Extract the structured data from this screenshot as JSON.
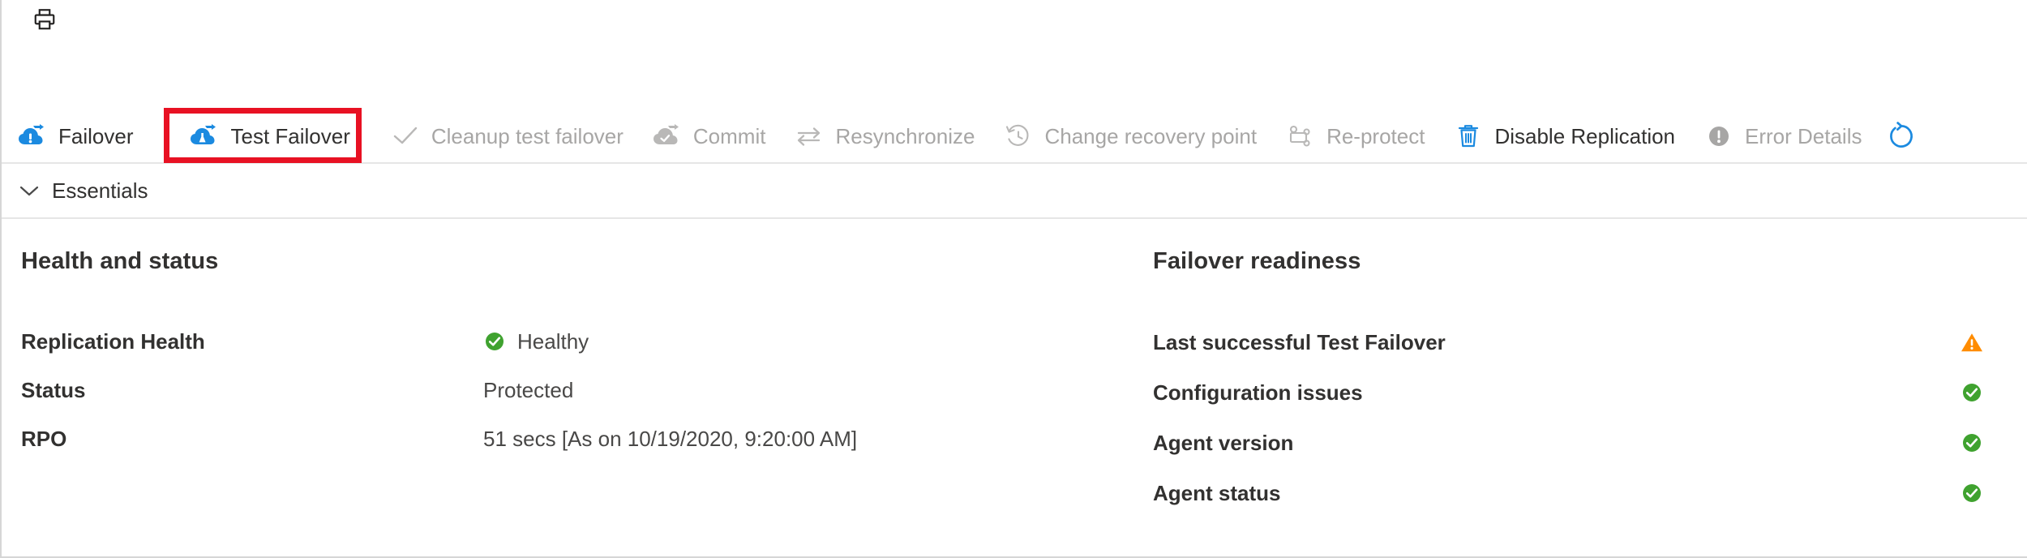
{
  "topbar": {
    "print_icon": "print-icon",
    "clipped_left_icons": [
      "partial-blue-icon-1",
      "partial-blue-icon-2"
    ]
  },
  "commandbar": {
    "items": [
      {
        "label": "Failover",
        "icon": "failover-cloud-icon",
        "enabled": true,
        "name": "failover"
      },
      {
        "label": "Test Failover",
        "icon": "test-failover-cloud-icon",
        "enabled": true,
        "name": "test-failover",
        "highlighted": true
      },
      {
        "label": "Cleanup test failover",
        "icon": "checkmark-icon",
        "enabled": false,
        "name": "cleanup-test-failover"
      },
      {
        "label": "Commit",
        "icon": "commit-cloud-check-icon",
        "enabled": false,
        "name": "commit"
      },
      {
        "label": "Resynchronize",
        "icon": "resynchronize-arrows-icon",
        "enabled": false,
        "name": "resynchronize"
      },
      {
        "label": "Change recovery point",
        "icon": "history-clock-icon",
        "enabled": false,
        "name": "change-recovery-point"
      },
      {
        "label": "Re-protect",
        "icon": "re-protect-icon",
        "enabled": false,
        "name": "re-protect"
      },
      {
        "label": "Disable Replication",
        "icon": "trash-icon",
        "enabled": true,
        "name": "disable-replication"
      },
      {
        "label": "Error Details",
        "icon": "error-circle-icon",
        "enabled": false,
        "name": "error-details"
      }
    ],
    "refresh_icon": "refresh-icon",
    "highlight_color": "#e81123"
  },
  "essentials": {
    "label": "Essentials",
    "chevron_icon": "chevron-down-icon",
    "expanded": true
  },
  "health_and_status": {
    "title": "Health and status",
    "rows": [
      {
        "key": "Replication Health",
        "value": "Healthy",
        "icon": "green-check-icon"
      },
      {
        "key": "Status",
        "value": "Protected",
        "icon": ""
      },
      {
        "key": "RPO",
        "value": "51 secs [As on 10/19/2020, 9:20:00 AM]",
        "icon": ""
      }
    ]
  },
  "failover_readiness": {
    "title": "Failover readiness",
    "rows": [
      {
        "label": "Last successful Test Failover",
        "icon": "orange-warning-icon"
      },
      {
        "label": "Configuration issues",
        "icon": "green-check-icon"
      },
      {
        "label": "Agent version",
        "icon": "green-check-icon"
      },
      {
        "label": "Agent status",
        "icon": "green-check-icon"
      }
    ]
  },
  "colors": {
    "accent_blue": "#0078d4",
    "healthy_green": "#3fa22f",
    "warning_orange": "#ff8c00",
    "disabled_gray": "#a7a6a5",
    "text": "#323130",
    "highlight_red": "#e81123"
  }
}
